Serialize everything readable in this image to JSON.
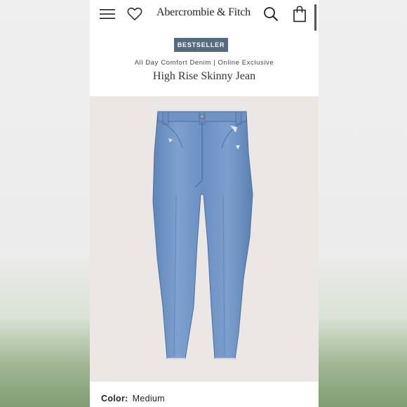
{
  "header": {
    "brand": "Abercrombie & Fitch",
    "icons": [
      "menu-icon",
      "heart-icon",
      "search-icon",
      "bag-icon"
    ]
  },
  "product": {
    "badge": "BESTSELLER",
    "subtitle": "All Day Comfort Denim | Online Exclusive",
    "title": "High Rise Skinny Jean",
    "color_label": "Color:",
    "color_value": "Medium"
  },
  "colors": {
    "badge_bg": "#566b80",
    "image_bg": "#ebe7e5",
    "denim": "#6f93c3"
  }
}
